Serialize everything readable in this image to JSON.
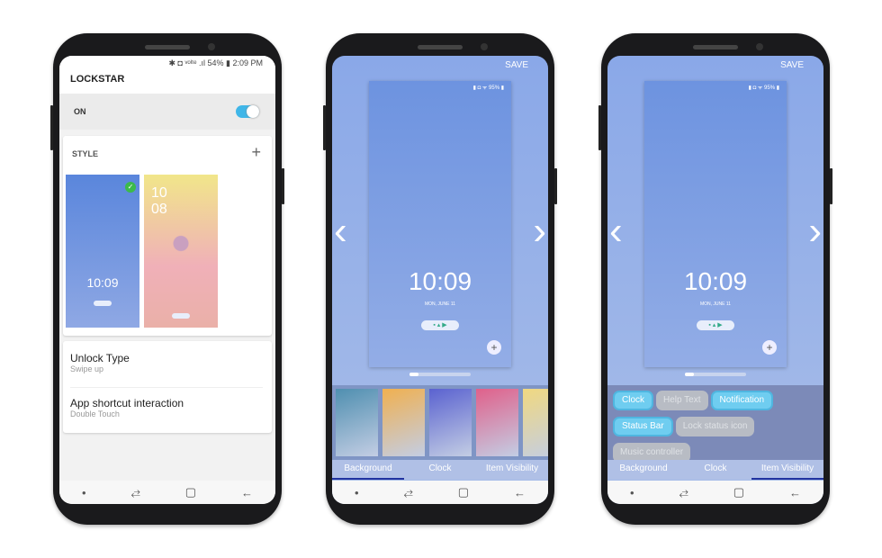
{
  "phone1": {
    "status": "✱ ◘ ᵛᵒˡᵗᵉ .ıl 54% ▮ 2:09 PM",
    "title": "LOCKSTAR",
    "toggle_label": "ON",
    "toggle_on": true,
    "style_label": "STYLE",
    "add": "+",
    "thumb1_clock": "10:09",
    "thumb2_clock": "10\n08",
    "rows": [
      {
        "title": "Unlock Type",
        "sub": "Swipe up"
      },
      {
        "title": "App shortcut interaction",
        "sub": "Double Touch"
      }
    ]
  },
  "editor": {
    "save": "SAVE",
    "status": "▮ ◘ ᯤ 95% ▮",
    "clock": "10:09",
    "date": "MON, JUNE 11",
    "add": "+",
    "prev": "‹",
    "next": "›"
  },
  "tabs": [
    "Background",
    "Clock",
    "Item Visibility"
  ],
  "tab_icons": [
    "image-icon",
    "clock-icon",
    "visibility-icon"
  ],
  "phone2_active_tab": 0,
  "phone3_active_tab": 2,
  "backgrounds": [
    "#4f8fb0",
    "#f0b050",
    "#5a62d0",
    "#e0608a",
    "#f0d880"
  ],
  "chips": [
    {
      "label": "Clock",
      "on": true
    },
    {
      "label": "Help Text",
      "on": false
    },
    {
      "label": "Notification",
      "on": true
    },
    {
      "label": "Status Bar",
      "on": true
    },
    {
      "label": "Lock status icon",
      "on": false
    },
    {
      "label": "Music controller",
      "on": false
    }
  ],
  "nav": {
    "dot": "•",
    "recent": "⥄",
    "home": "▢",
    "back": "←"
  },
  "colors": {
    "toggle": "#3fb6e8",
    "accent": "#2234a0",
    "check": "#3cba4a"
  }
}
